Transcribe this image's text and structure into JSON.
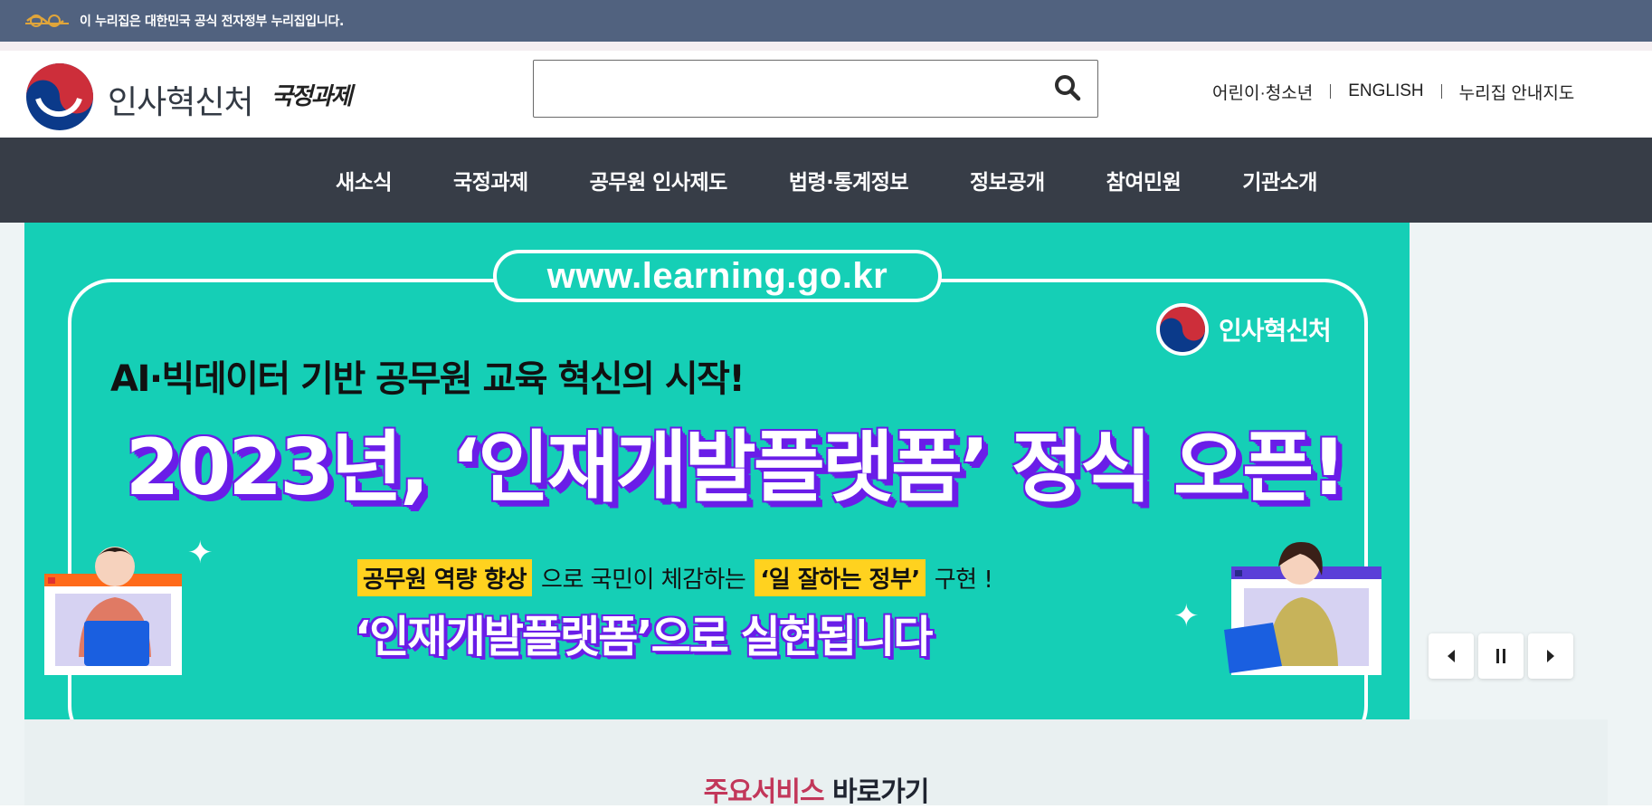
{
  "gov_banner": {
    "text": "이 누리집은 대한민국 공식 전자정부 누리집입니다.",
    "emblem_icon": "egov-icon"
  },
  "header": {
    "logo_text": "인사혁신처",
    "logo_tag": "국정과제",
    "search": {
      "value": "",
      "placeholder": ""
    },
    "util_links": [
      {
        "label": "어린이·청소년"
      },
      {
        "label": "ENGLISH"
      },
      {
        "label": "누리집 안내지도"
      }
    ]
  },
  "nav": {
    "items": [
      {
        "label": "새소식"
      },
      {
        "label": "국정과제"
      },
      {
        "label": "공무원 인사제도"
      },
      {
        "label": "법령·통계정보"
      },
      {
        "label": "정보공개"
      },
      {
        "label": "참여민원"
      },
      {
        "label": "기관소개"
      }
    ]
  },
  "hero": {
    "url": "www.learning.go.kr",
    "brand": "인사혁신처",
    "subtitle": "AI·빅데이터 기반 공무원 교육 혁신의 시작!",
    "title": "2023년, ‘인재개발플랫폼’ 정식 오픈!",
    "line1": {
      "highlight1": "공무원 역량 향상",
      "middle": "으로 국민이 체감하는",
      "highlight2": "‘일 잘하는 정부’",
      "end": "구현 !"
    },
    "line2": "‘인재개발플랫폼’으로 실현됩니다",
    "colors": {
      "background": "#15cfb6",
      "accent": "#6a1de8",
      "highlight": "#ffd21f"
    }
  },
  "slider": {
    "prev_icon": "prev-icon",
    "pause_icon": "pause-icon",
    "next_icon": "next-icon"
  },
  "services": {
    "title_accent": "주요서비스",
    "title_rest": "바로가기"
  }
}
